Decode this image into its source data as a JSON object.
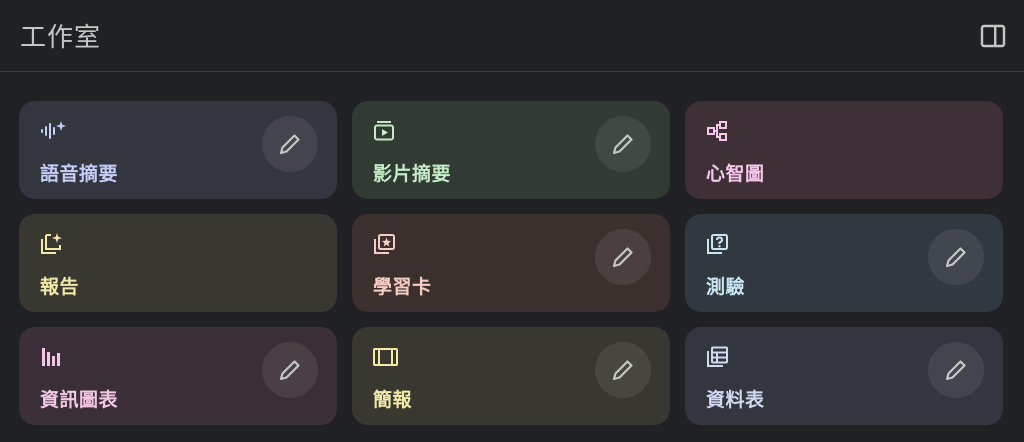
{
  "header": {
    "title": "工作室"
  },
  "cards": [
    {
      "label": "語音摘要",
      "icon": "audio-sparkle-icon",
      "edit": true,
      "bg": "#33353f",
      "accent": "#c6cdf7"
    },
    {
      "label": "影片摘要",
      "icon": "video-play-icon",
      "edit": true,
      "bg": "#313a33",
      "accent": "#c4ecc6"
    },
    {
      "label": "心智圖",
      "icon": "mind-map-icon",
      "edit": false,
      "bg": "#3e3036",
      "accent": "#f5c6ea"
    },
    {
      "label": "報告",
      "icon": "report-sparkle-icon",
      "edit": false,
      "bg": "#383730",
      "accent": "#f3e8a8"
    },
    {
      "label": "學習卡",
      "icon": "flashcard-star-icon",
      "edit": true,
      "bg": "#3c302f",
      "accent": "#f6cdc4"
    },
    {
      "label": "測驗",
      "icon": "quiz-icon",
      "edit": true,
      "bg": "#323840",
      "accent": "#c8e6f2"
    },
    {
      "label": "資訊圖表",
      "icon": "infographic-icon",
      "edit": true,
      "bg": "#3a2f36",
      "accent": "#f3c6e4"
    },
    {
      "label": "簡報",
      "icon": "slides-icon",
      "edit": true,
      "bg": "#383830",
      "accent": "#f1eaa8"
    },
    {
      "label": "資料表",
      "icon": "data-table-icon",
      "edit": true,
      "bg": "#33363f",
      "accent": "#d2d8f0"
    }
  ]
}
